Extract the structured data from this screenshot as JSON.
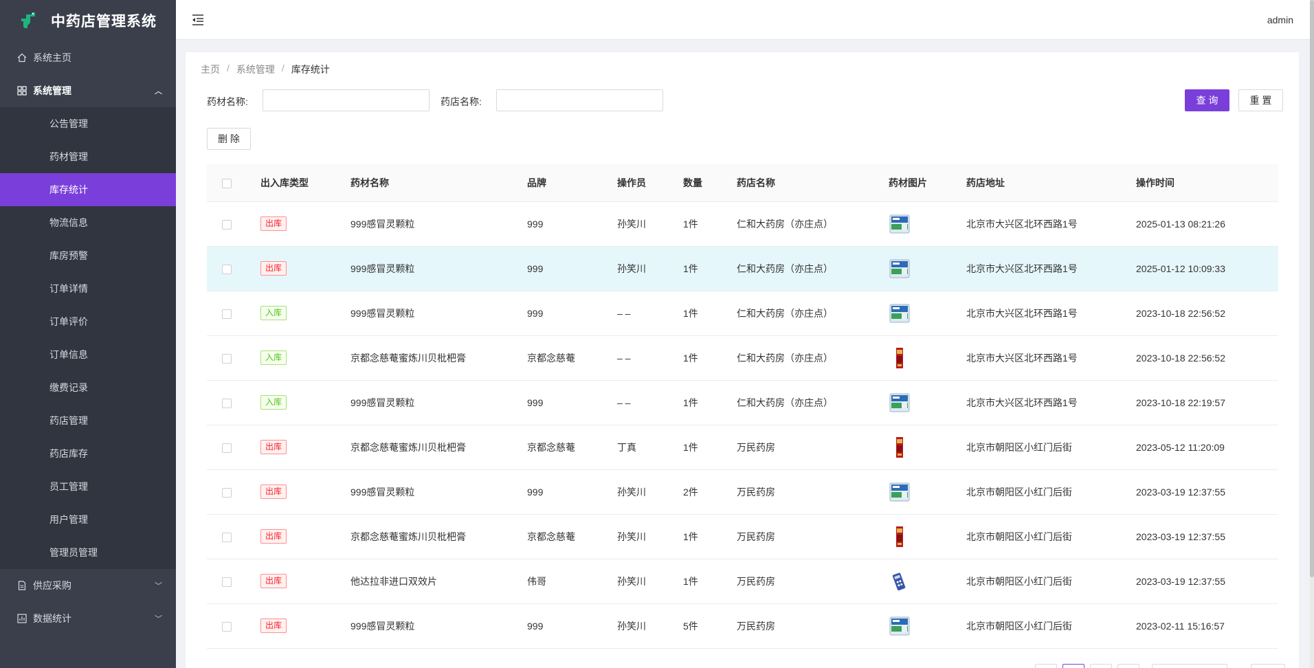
{
  "app": {
    "title": "中药店管理系统"
  },
  "sidebar": {
    "items": [
      {
        "label": "系统主页",
        "icon": "home-icon"
      },
      {
        "label": "系统管理",
        "icon": "grid-icon",
        "open": true,
        "children": [
          {
            "label": "公告管理"
          },
          {
            "label": "药材管理"
          },
          {
            "label": "库存统计",
            "active": true
          },
          {
            "label": "物流信息"
          },
          {
            "label": "库房预警"
          },
          {
            "label": "订单详情"
          },
          {
            "label": "订单评价"
          },
          {
            "label": "订单信息"
          },
          {
            "label": "缴费记录"
          },
          {
            "label": "药店管理"
          },
          {
            "label": "药店库存"
          },
          {
            "label": "员工管理"
          },
          {
            "label": "用户管理"
          },
          {
            "label": "管理员管理"
          }
        ]
      },
      {
        "label": "供应采购",
        "icon": "document-icon"
      },
      {
        "label": "数据统计",
        "icon": "chart-icon"
      }
    ]
  },
  "header": {
    "user": "admin"
  },
  "breadcrumb": [
    "主页",
    "系统管理",
    "库存统计"
  ],
  "filters": {
    "medicine_label": "药材名称:",
    "medicine_value": "",
    "store_label": "药店名称:",
    "store_value": ""
  },
  "buttons": {
    "query": "查 询",
    "reset": "重 置",
    "delete": "删 除"
  },
  "table": {
    "headers": [
      "出入库类型",
      "药材名称",
      "品牌",
      "操作员",
      "数量",
      "药店名称",
      "药材图片",
      "药店地址",
      "操作时间"
    ],
    "rows": [
      {
        "type": "出库",
        "name": "999感冒灵颗粒",
        "brand": "999",
        "operator": "孙笑川",
        "qty": "1件",
        "store": "仁和大药房（亦庄点）",
        "img": "granule",
        "address": "北京市大兴区北环西路1号",
        "time": "2025-01-13 08:21:26"
      },
      {
        "type": "出库",
        "name": "999感冒灵颗粒",
        "brand": "999",
        "operator": "孙笑川",
        "qty": "1件",
        "store": "仁和大药房（亦庄点）",
        "img": "granule",
        "address": "北京市大兴区北环西路1号",
        "time": "2025-01-12 10:09:33",
        "highlight": true
      },
      {
        "type": "入库",
        "name": "999感冒灵颗粒",
        "brand": "999",
        "operator": "– –",
        "qty": "1件",
        "store": "仁和大药房（亦庄点）",
        "img": "granule",
        "address": "北京市大兴区北环西路1号",
        "time": "2023-10-18 22:56:52"
      },
      {
        "type": "入库",
        "name": "京都念慈菴蜜炼川贝枇杷膏",
        "brand": "京都念慈菴",
        "operator": "– –",
        "qty": "1件",
        "store": "仁和大药房（亦庄点）",
        "img": "syrup",
        "address": "北京市大兴区北环西路1号",
        "time": "2023-10-18 22:56:52"
      },
      {
        "type": "入库",
        "name": "999感冒灵颗粒",
        "brand": "999",
        "operator": "– –",
        "qty": "1件",
        "store": "仁和大药房（亦庄点）",
        "img": "granule",
        "address": "北京市大兴区北环西路1号",
        "time": "2023-10-18 22:19:57"
      },
      {
        "type": "出库",
        "name": "京都念慈菴蜜炼川贝枇杷膏",
        "brand": "京都念慈菴",
        "operator": "丁真",
        "qty": "1件",
        "store": "万民药房",
        "img": "syrup",
        "address": "北京市朝阳区小红门后街",
        "time": "2023-05-12 11:20:09"
      },
      {
        "type": "出库",
        "name": "999感冒灵颗粒",
        "brand": "999",
        "operator": "孙笑川",
        "qty": "2件",
        "store": "万民药房",
        "img": "granule",
        "address": "北京市朝阳区小红门后街",
        "time": "2023-03-19 12:37:55"
      },
      {
        "type": "出库",
        "name": "京都念慈菴蜜炼川贝枇杷膏",
        "brand": "京都念慈菴",
        "operator": "孙笑川",
        "qty": "1件",
        "store": "万民药房",
        "img": "syrup",
        "address": "北京市朝阳区小红门后街",
        "time": "2023-03-19 12:37:55"
      },
      {
        "type": "出库",
        "name": "他达拉非进口双效片",
        "brand": "伟哥",
        "operator": "孙笑川",
        "qty": "1件",
        "store": "万民药房",
        "img": "tablet",
        "address": "北京市朝阳区小红门后街",
        "time": "2023-03-19 12:37:55"
      },
      {
        "type": "出库",
        "name": "999感冒灵颗粒",
        "brand": "999",
        "operator": "孙笑川",
        "qty": "5件",
        "store": "万民药房",
        "img": "granule",
        "address": "北京市朝阳区小红门后街",
        "time": "2023-02-11 15:16:57"
      }
    ]
  },
  "colors": {
    "accent": "#7a3fdb",
    "sidebar_bg": "#3a3f4b",
    "out_tag": "#f5222d",
    "in_tag": "#52c41a"
  }
}
